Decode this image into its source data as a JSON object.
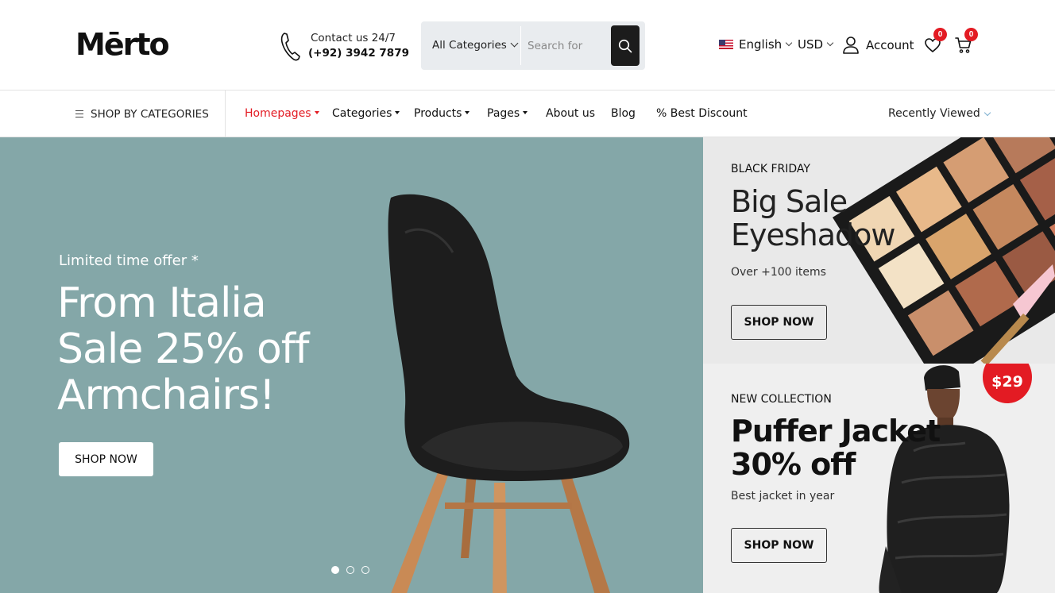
{
  "header": {
    "logo": "Mērto",
    "contact_line1": "Contact us 24/7",
    "contact_line2": "(+92) 3942 7879",
    "search": {
      "category": "All Categories",
      "placeholder": "Search for"
    },
    "language": "English",
    "currency": "USD",
    "account_label": "Account",
    "wishlist_count": "0",
    "cart_count": "0"
  },
  "nav": {
    "shop_by_categories": "SHOP BY CATEGORIES",
    "items": [
      {
        "label": "Homepages",
        "active": true
      },
      {
        "label": "Categories"
      },
      {
        "label": "Products"
      },
      {
        "label": "Pages"
      },
      {
        "label": "About us"
      },
      {
        "label": "Blog"
      },
      {
        "label": "% Best Discount"
      }
    ],
    "recently_viewed": "Recently Viewed"
  },
  "hero": {
    "tag": "Limited time offer *",
    "title_line1": "From Italia",
    "title_line2": "Sale 25% off",
    "title_line3": "Armchairs!",
    "button": "SHOP NOW",
    "bg_color": "#84a7a8",
    "slide_count": 3,
    "active_slide": 1
  },
  "banners": [
    {
      "tag": "BLACK FRIDAY",
      "title_line1": "Big Sale",
      "title_line2": "Eyeshadow",
      "subtitle": "Over +100 items",
      "button": "SHOP NOW"
    },
    {
      "tag": "NEW COLLECTION",
      "title_line1": "Puffer Jacket",
      "title_line2": "30% off",
      "subtitle": "Best jacket in year",
      "button": "SHOP NOW",
      "price_badge": "$29"
    }
  ],
  "colors": {
    "accent": "#e31b23",
    "dark": "#1c1c1c"
  }
}
